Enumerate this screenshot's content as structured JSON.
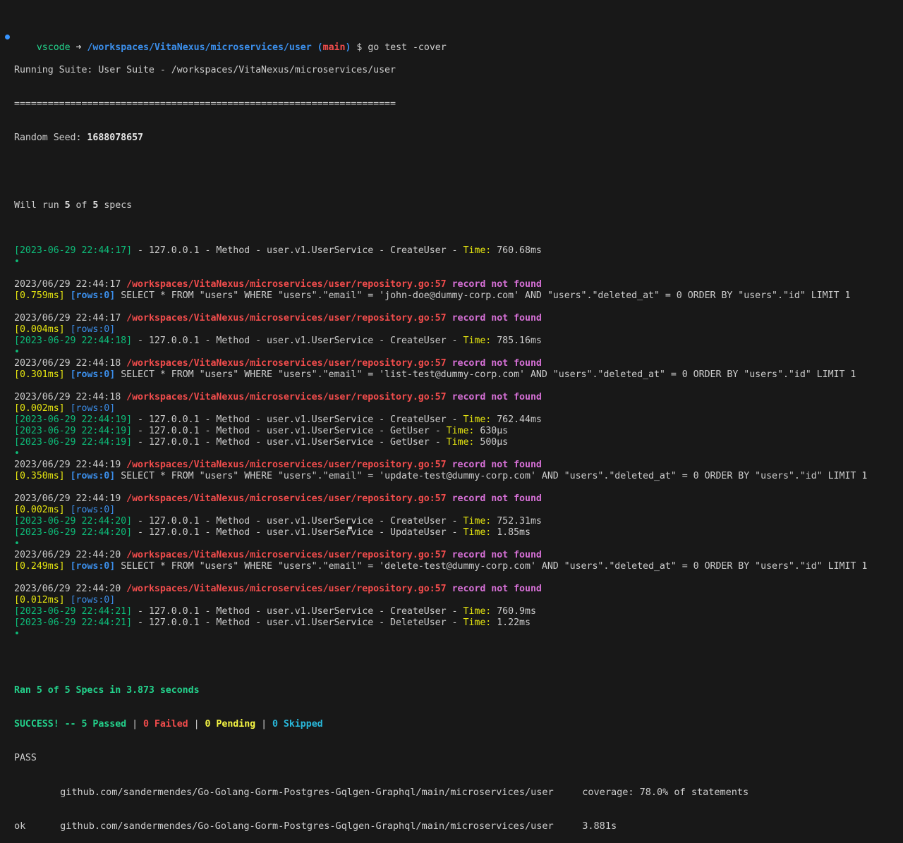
{
  "prompt": {
    "user": "vscode",
    "arrow": "➜",
    "cwd": "/workspaces/VitaNexus/microservices/user",
    "branch": "main",
    "symbol": "$",
    "command": "go test -cover"
  },
  "suite": {
    "running": "Running Suite: User Suite - /workspaces/VitaNexus/microservices/user",
    "separator": "====================================================================",
    "seed_label": "Random Seed: ",
    "seed_value": "1688078657",
    "will_run_prefix": "Will run ",
    "will_run_count": "5",
    "will_run_of": " of ",
    "will_run_total": "5",
    "will_run_suffix": " specs"
  },
  "common": {
    "bullet": "•",
    "rpc_mid": " - 127.0.0.1 - Method - user.v1.UserService - ",
    "time_label": "Time:",
    "repo_path": "/workspaces/VitaNexus/microservices/user/repository.go:57",
    "not_found": "record not found",
    "rows": "[rows:0]",
    "sql_pre": " SELECT * FROM \"users\" WHERE \"users\".\"email\" = '",
    "sql_post": "' AND \"users\".\"deleted_at\" = 0 ORDER BY \"users\".\"id\" LIMIT 1"
  },
  "log": [
    {
      "type": "rpc",
      "ts": "[2023-06-29 22:44:17]",
      "method": "CreateUser",
      "time": "760.68ms"
    },
    {
      "type": "bullet"
    },
    {
      "type": "blank"
    },
    {
      "type": "gorm",
      "date": "2023/06/29 22:44:17"
    },
    {
      "type": "sql",
      "dur": "[0.759ms]",
      "email": "john-doe@dummy-corp.com"
    },
    {
      "type": "blank"
    },
    {
      "type": "gorm",
      "date": "2023/06/29 22:44:17"
    },
    {
      "type": "rows",
      "dur": "[0.004ms]"
    },
    {
      "type": "rpc",
      "ts": "[2023-06-29 22:44:18]",
      "method": "CreateUser",
      "time": "785.16ms"
    },
    {
      "type": "bullet"
    },
    {
      "type": "gorm",
      "date": "2023/06/29 22:44:18"
    },
    {
      "type": "sql",
      "dur": "[0.301ms]",
      "email": "list-test@dummy-corp.com"
    },
    {
      "type": "blank"
    },
    {
      "type": "gorm",
      "date": "2023/06/29 22:44:18"
    },
    {
      "type": "rows",
      "dur": "[0.002ms]"
    },
    {
      "type": "rpc",
      "ts": "[2023-06-29 22:44:19]",
      "method": "CreateUser",
      "time": "762.44ms"
    },
    {
      "type": "rpc",
      "ts": "[2023-06-29 22:44:19]",
      "method": "GetUser",
      "time": "630µs"
    },
    {
      "type": "rpc",
      "ts": "[2023-06-29 22:44:19]",
      "method": "GetUser",
      "time": "500µs"
    },
    {
      "type": "bullet"
    },
    {
      "type": "gorm",
      "date": "2023/06/29 22:44:19"
    },
    {
      "type": "sql",
      "dur": "[0.350ms]",
      "email": "update-test@dummy-corp.com"
    },
    {
      "type": "blank"
    },
    {
      "type": "gorm",
      "date": "2023/06/29 22:44:19"
    },
    {
      "type": "rows",
      "dur": "[0.002ms]"
    },
    {
      "type": "rpc",
      "ts": "[2023-06-29 22:44:20]",
      "method": "CreateUser",
      "time": "752.31ms"
    },
    {
      "type": "rpc",
      "ts": "[2023-06-29 22:44:20]",
      "method": "UpdateUser",
      "time": "1.85ms"
    },
    {
      "type": "bullet"
    },
    {
      "type": "gorm",
      "date": "2023/06/29 22:44:20"
    },
    {
      "type": "sql",
      "dur": "[0.249ms]",
      "email": "delete-test@dummy-corp.com"
    },
    {
      "type": "blank"
    },
    {
      "type": "gorm",
      "date": "2023/06/29 22:44:20"
    },
    {
      "type": "rows",
      "dur": "[0.012ms]"
    },
    {
      "type": "rpc",
      "ts": "[2023-06-29 22:44:21]",
      "method": "CreateUser",
      "time": "760.9ms"
    },
    {
      "type": "rpc",
      "ts": "[2023-06-29 22:44:21]",
      "method": "DeleteUser",
      "time": "1.22ms"
    },
    {
      "type": "bullet"
    },
    {
      "type": "blank"
    }
  ],
  "summary": {
    "ran": "Ran 5 of 5 Specs in 3.873 seconds",
    "success": "SUCCESS! -- 5 Passed",
    "sep": " | ",
    "failed": "0 Failed",
    "pending": "0 Pending",
    "skipped": "0 Skipped",
    "pass": "PASS",
    "coverage_line": "        github.com/sandermendes/Go-Golang-Gorm-Postgres-Gqlgen-Graphql/main/microservices/user     coverage: 78.0% of statements",
    "ok_line": "ok      github.com/sandermendes/Go-Golang-Gorm-Postgres-Gqlgen-Graphql/main/microservices/user     3.881s"
  }
}
